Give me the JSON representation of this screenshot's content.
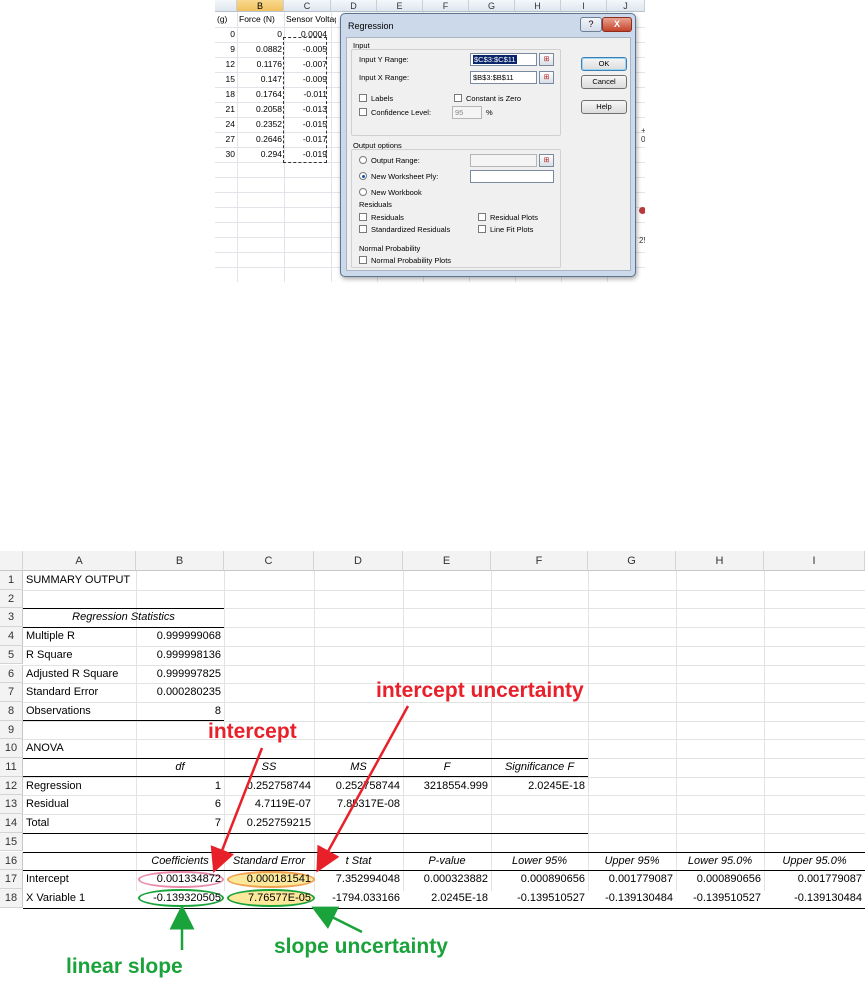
{
  "top_sheet": {
    "columns": [
      "",
      "B",
      "C",
      "D",
      "E",
      "F",
      "G",
      "H",
      "I",
      "J"
    ],
    "header_row": [
      "(g)",
      "Force (N)",
      "Sensor Voltage"
    ],
    "rows": [
      [
        "0",
        "0",
        "0.0004"
      ],
      [
        "9",
        "0.0882",
        "-0.005"
      ],
      [
        "12",
        "0.1176",
        "-0.007"
      ],
      [
        "15",
        "0.147",
        "-0.009"
      ],
      [
        "18",
        "0.1764",
        "-0.011"
      ],
      [
        "21",
        "0.2058",
        "-0.013"
      ],
      [
        "24",
        "0.2352",
        "-0.015"
      ],
      [
        "27",
        "0.2646",
        "-0.017"
      ],
      [
        "30",
        "0.294",
        "-0.019"
      ]
    ],
    "behind_fragments": {
      "plus": "+ 0",
      "num": "25"
    }
  },
  "dialog": {
    "title": "Regression",
    "help_glyph": "?",
    "close_glyph": "X",
    "input_section": "Input",
    "y_range_label": "Input Y Range:",
    "y_range_value": "$C$3:$C$11",
    "x_range_label": "Input X Range:",
    "x_range_value": "$B$3:$B$11",
    "labels_label": "Labels",
    "constant_zero_label": "Constant is Zero",
    "confidence_label": "Confidence Level:",
    "confidence_value": "95",
    "percent": "%",
    "output_section": "Output options",
    "output_range_label": "Output Range:",
    "new_ply_label": "New Worksheet Ply:",
    "new_workbook_label": "New Workbook",
    "residuals_section": "Residuals",
    "residuals_label": "Residuals",
    "std_residuals_label": "Standardized Residuals",
    "residual_plots_label": "Residual Plots",
    "line_fit_label": "Line Fit Plots",
    "normal_prob_section": "Normal Probability",
    "normal_plots_label": "Normal Probability Plots",
    "ok_label": "OK",
    "cancel_label": "Cancel",
    "help_label": "Help",
    "range_button_glyph": "⊞"
  },
  "bottom_sheet": {
    "columns": [
      "A",
      "B",
      "C",
      "D",
      "E",
      "F",
      "G",
      "H",
      "I"
    ],
    "row_numbers": [
      "1",
      "2",
      "3",
      "4",
      "5",
      "6",
      "7",
      "8",
      "9",
      "10",
      "11",
      "12",
      "13",
      "14",
      "15",
      "16",
      "17",
      "18"
    ],
    "summary_title": "SUMMARY OUTPUT",
    "regression_stats_title": "Regression Statistics",
    "stats": [
      [
        "Multiple R",
        "0.999999068"
      ],
      [
        "R Square",
        "0.999998136"
      ],
      [
        "Adjusted R Square",
        "0.999997825"
      ],
      [
        "Standard Error",
        "0.000280235"
      ],
      [
        "Observations",
        "8"
      ]
    ],
    "anova_title": "ANOVA",
    "anova_headers": [
      "df",
      "SS",
      "MS",
      "F",
      "Significance F"
    ],
    "anova_rows": [
      [
        "Regression",
        "1",
        "0.252758744",
        "0.252758744",
        "3218554.999",
        "2.0245E-18"
      ],
      [
        "Residual",
        "6",
        "4.7119E-07",
        "7.85317E-08",
        "",
        ""
      ],
      [
        "Total",
        "7",
        "0.252759215",
        "",
        "",
        ""
      ]
    ],
    "coef_headers": [
      "Coefficients",
      "Standard Error",
      "t Stat",
      "P-value",
      "Lower 95%",
      "Upper 95%",
      "Lower 95.0%",
      "Upper 95.0%"
    ],
    "coef_rows": [
      [
        "Intercept",
        "0.001334872",
        "0.000181541",
        "7.352994048",
        "0.000323882",
        "0.000890656",
        "0.001779087",
        "0.000890656",
        "0.001779087"
      ],
      [
        "X Variable 1",
        "-0.139320505",
        "7.76577E-05",
        "-1794.033166",
        "2.0245E-18",
        "-0.139510527",
        "-0.139130484",
        "-0.139510527",
        "-0.139130484"
      ]
    ]
  },
  "annotations": {
    "intercept": "intercept",
    "intercept_uncertainty": "intercept uncertainty",
    "linear_slope": "linear slope",
    "slope_uncertainty": "slope uncertainty",
    "red": "#e8202a",
    "green": "#1aa33a",
    "pink": "#e98aa8",
    "orange": "#f0a050",
    "highlight": "#fbe89a"
  }
}
